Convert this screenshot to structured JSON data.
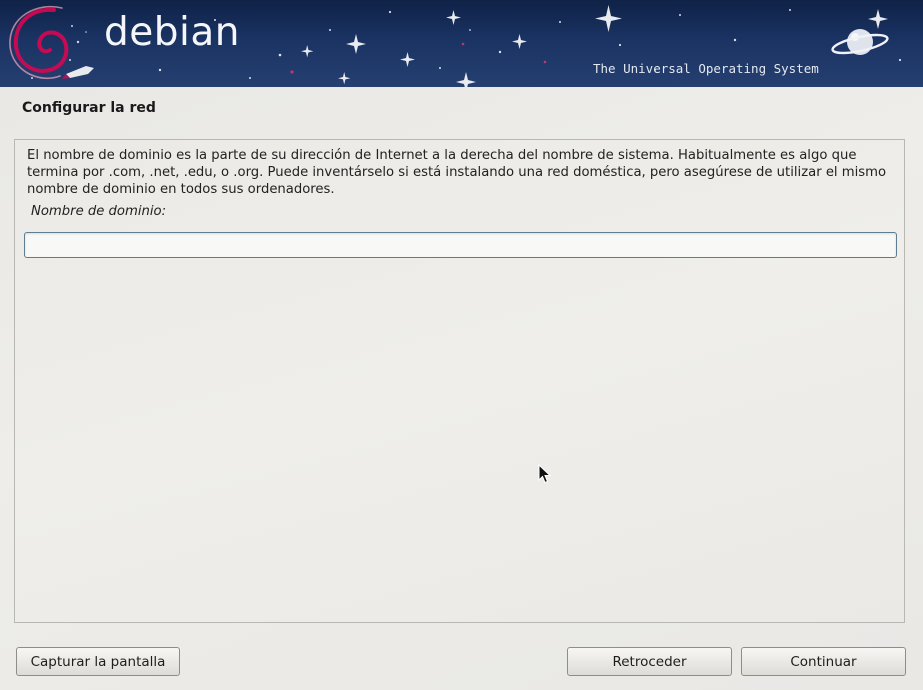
{
  "banner": {
    "logo_text": "debian",
    "tagline": "The Universal Operating System",
    "colors": {
      "background": "#1a3363",
      "text": "#f4f6fa",
      "swirl": "#d70751"
    }
  },
  "page": {
    "title": "Configurar la red"
  },
  "content": {
    "description": "El nombre de dominio es la parte de su dirección de Internet a la derecha del nombre de sistema. Habitualmente es algo que termina por .com, .net, .edu, o .org. Puede inventárselo si está instalando una red doméstica, pero asegúrese de utilizar el mismo nombre de dominio en todos sus ordenadores.",
    "field_label": "Nombre de dominio:",
    "field_value": ""
  },
  "buttons": {
    "screenshot": "Capturar la pantalla",
    "back": "Retroceder",
    "continue": "Continuar"
  },
  "icons": {
    "logo": "debian-swirl-icon",
    "planet": "planet-icon",
    "rocket": "rocket-icon",
    "cursor": "mouse-cursor-icon"
  }
}
